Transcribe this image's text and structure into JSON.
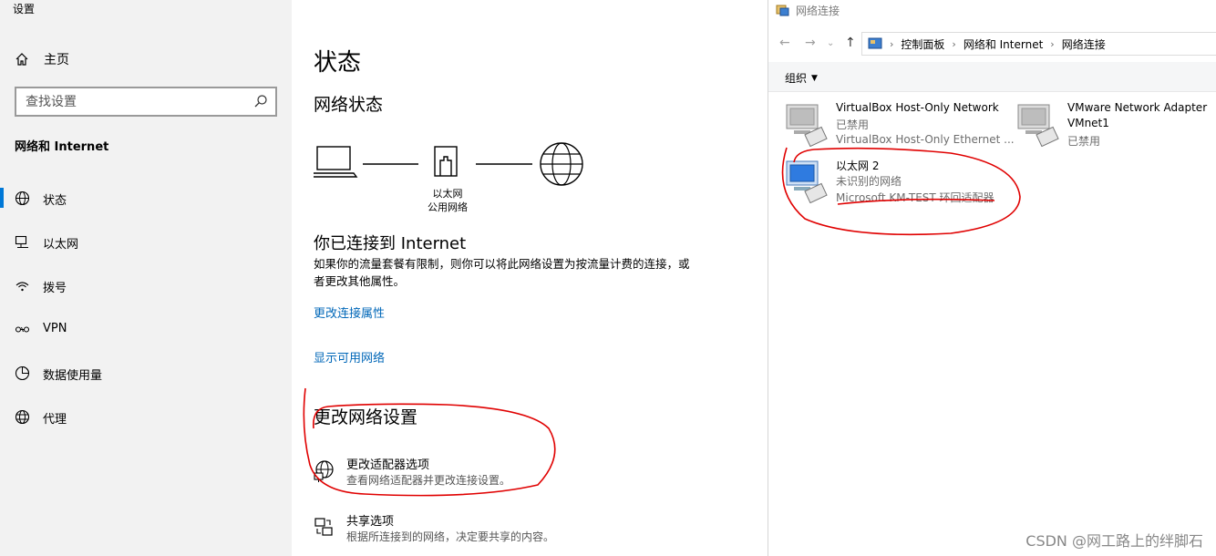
{
  "settings": {
    "app_title": "设置",
    "home_label": "主页",
    "search_placeholder": "查找设置",
    "section_title": "网络和 Internet",
    "nav": [
      {
        "label": "状态",
        "icon": "globe-icon",
        "selected": true
      },
      {
        "label": "以太网",
        "icon": "ethernet-icon",
        "selected": false
      },
      {
        "label": "拨号",
        "icon": "dialup-icon",
        "selected": false
      },
      {
        "label": "VPN",
        "icon": "vpn-icon",
        "selected": false
      },
      {
        "label": "数据使用量",
        "icon": "data-usage-icon",
        "selected": false
      },
      {
        "label": "代理",
        "icon": "proxy-icon",
        "selected": false
      }
    ]
  },
  "status": {
    "page_title": "状态",
    "network_status_heading": "网络状态",
    "diagram_line1": "以太网",
    "diagram_line2": "公用网络",
    "connected_heading": "你已连接到 Internet",
    "description": "如果你的流量套餐有限制，则你可以将此网络设置为按流量计费的连接，或者更改其他属性。",
    "link_change_properties": "更改连接属性",
    "link_show_networks": "显示可用网络",
    "change_settings_heading": "更改网络设置",
    "options": [
      {
        "title": "更改适配器选项",
        "subtitle": "查看网络适配器并更改连接设置。",
        "icon": "adapter-options-icon"
      },
      {
        "title": "共享选项",
        "subtitle": "根据所连接到的网络，决定要共享的内容。",
        "icon": "sharing-options-icon"
      }
    ]
  },
  "netconn": {
    "window_title": "网络连接",
    "breadcrumbs": [
      "控制面板",
      "网络和 Internet",
      "网络连接"
    ],
    "organize_label": "组织",
    "adapters": [
      {
        "name": "VirtualBox Host-Only Network",
        "status": "已禁用",
        "device": "VirtualBox Host-Only Ethernet ..."
      },
      {
        "name": "VMware Network Adapter",
        "status": "VMnet1",
        "device": "已禁用"
      },
      {
        "name": "以太网 2",
        "status": "未识别的网络",
        "device": "Microsoft KM-TEST 环回适配器"
      }
    ]
  },
  "watermark": "CSDN @网工路上的绊脚石",
  "colors": {
    "accent": "#0078d7",
    "link": "#0067b8",
    "annotation": "#e00000"
  }
}
